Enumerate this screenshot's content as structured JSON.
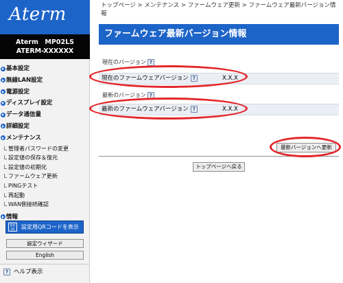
{
  "logo": {
    "text": "Aterm"
  },
  "device": {
    "model": "Aterm　MP02LS",
    "name": "ATERM-XXXXXX"
  },
  "sidebar": {
    "menu": [
      {
        "label": "基本設定"
      },
      {
        "label": "無線LAN設定"
      },
      {
        "label": "電源設定"
      },
      {
        "label": "ディスプレイ設定"
      },
      {
        "label": "データ通信量"
      },
      {
        "label": "詳細設定"
      },
      {
        "label": "メンテナンス"
      }
    ],
    "maintenance_items": [
      {
        "label": "管理者パスワードの変更"
      },
      {
        "label": "設定値の保存＆復元"
      },
      {
        "label": "設定値の初期化"
      },
      {
        "label": "ファームウェア更新"
      },
      {
        "label": "PINGテスト"
      },
      {
        "label": "再起動"
      },
      {
        "label": "WAN側接続確認"
      }
    ],
    "info": {
      "label": "情報"
    },
    "qr_button": {
      "label": "設定用QRコードを表示",
      "icon_text": "設定 QR"
    },
    "wizard_button": "設定ウィザード",
    "english_button": "English",
    "help": {
      "icon": "?",
      "label": "ヘルプ表示"
    }
  },
  "breadcrumb": "トップページ > メンテナンス > ファームウェア更新 > ファームウェア最新バージョン情報",
  "page_title": "ファームウェア最新バージョン情報",
  "current_section": {
    "heading": "現在のバージョン",
    "row_label": "現在のファームウェアバージョン",
    "value": "X.X.X"
  },
  "latest_section": {
    "heading": "最新のバージョン",
    "row_label": "最新のファームウェアバージョン",
    "value": "X.X.X"
  },
  "update_button": "最新バージョンへ更新",
  "top_page_button": "トップページへ戻る",
  "help_icon": "?",
  "colors": {
    "accent": "#1d64c8",
    "highlight": "#e3262b"
  }
}
